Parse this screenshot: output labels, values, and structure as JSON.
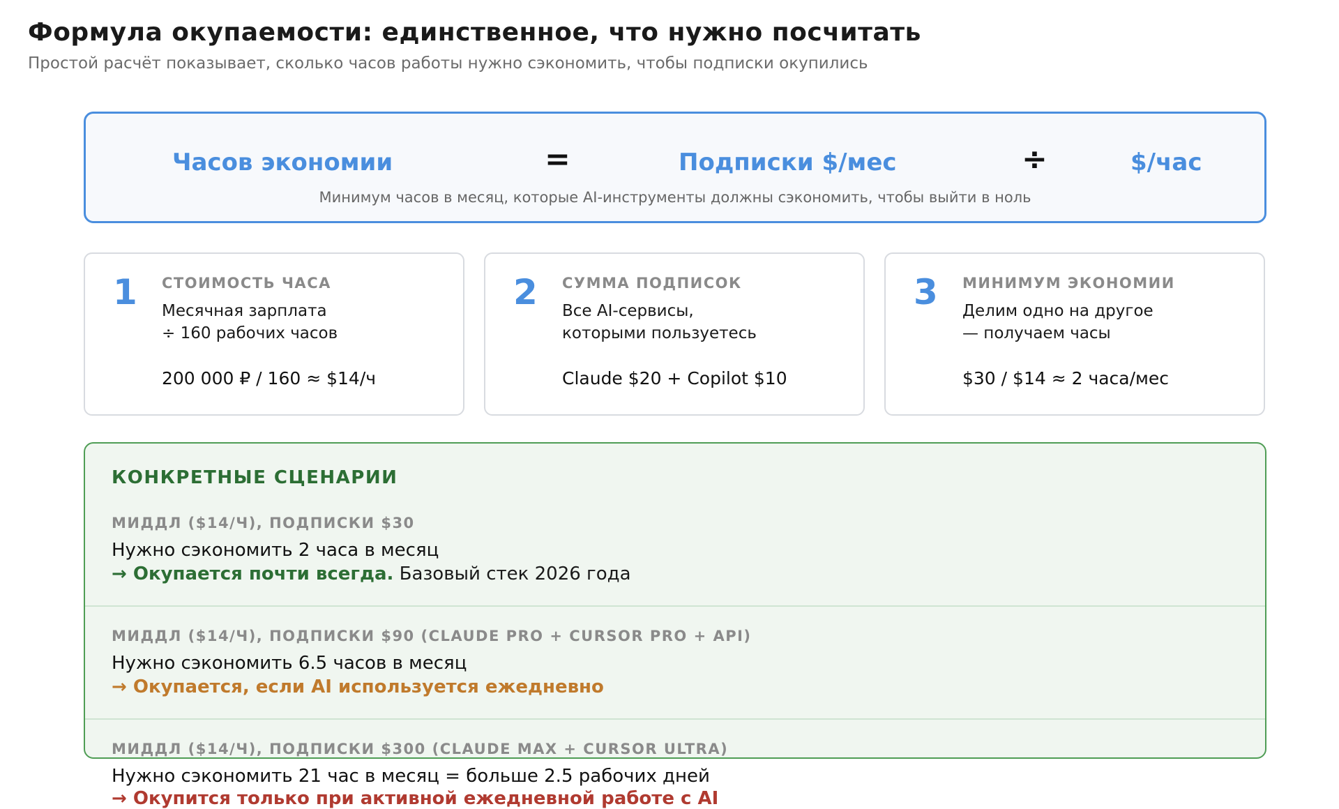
{
  "header": {
    "title": "Формула окупаемости: единственное, что нужно посчитать",
    "subtitle": "Простой расчёт показывает, сколько часов работы нужно сэкономить, чтобы подписки окупились"
  },
  "formula": {
    "hours_label": "Часов экономии",
    "equals": "=",
    "subscriptions_label": "Подписки $/мес",
    "divide": "÷",
    "rate_label": "$/час",
    "caption": "Минимум часов в месяц, которые AI-инструменты должны сэкономить, чтобы выйти в ноль"
  },
  "steps": [
    {
      "number": "1",
      "heading": "СТОИМОСТЬ ЧАСА",
      "line1": "Месячная зарплата",
      "line2": "÷ 160 рабочих часов",
      "example": "200 000 ₽ / 160 ≈ $14/ч"
    },
    {
      "number": "2",
      "heading": "СУММА ПОДПИСОК",
      "line1": "Все AI-сервисы,",
      "line2": "которыми пользуетесь",
      "example": "Claude $20 + Copilot $10"
    },
    {
      "number": "3",
      "heading": "МИНИМУМ ЭКОНОМИИ",
      "line1": "Делим одно на другое",
      "line2": "— получаем часы",
      "example": "$30 / $14 ≈ 2 часа/мес"
    }
  ],
  "scenarios": {
    "title": "КОНКРЕТНЫЕ СЦЕНАРИИ",
    "items": [
      {
        "label": "МИДДЛ ($14/ч), ПОДПИСКИ $30",
        "line": "Нужно сэкономить 2 часа в месяц",
        "verdict": "→ Окупается почти всегда.",
        "note": " Базовый стек 2026 года",
        "color": "#2c6e34"
      },
      {
        "label": "МИДДЛ ($14/ч), ПОДПИСКИ $90 (Claude Pro + Cursor Pro + API)",
        "line": "Нужно сэкономить 6.5 часов в месяц",
        "verdict": "→ Окупается, если AI используется ежедневно",
        "note": "",
        "color": "#c07a2c"
      },
      {
        "label": "МИДДЛ ($14/ч), ПОДПИСКИ $300 (Claude Max + Cursor Ultra)",
        "line": "Нужно сэкономить 21 час в месяц = больше 2.5 рабочих дней",
        "verdict": "→ Окупится только при активной ежедневной работе с AI",
        "note": "",
        "color": "#b03a30"
      }
    ]
  }
}
